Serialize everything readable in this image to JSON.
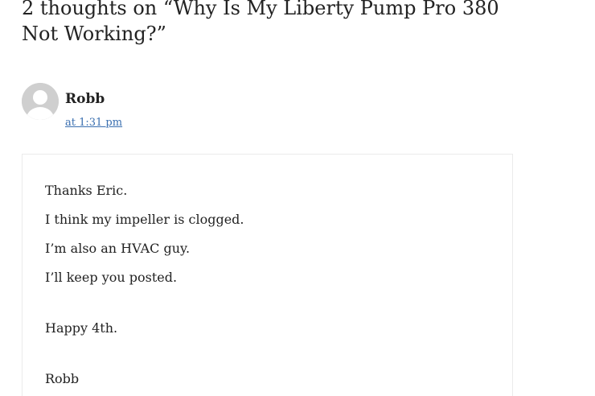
{
  "comments_title": "2 thoughts on “Why Is My Liberty Pump Pro 380 Not Working?”",
  "comment": {
    "author": "Robb",
    "time": "at 1:31 pm",
    "avatar_icon": "default-avatar-icon",
    "lines": [
      "Thanks Eric.",
      "I think my impeller is clogged.",
      "I’m also an HVAC guy.",
      "I’ll keep you posted.",
      "Happy 4th.",
      "Robb"
    ]
  },
  "colors": {
    "text": "#222222",
    "link": "#3a6fb0",
    "avatar_bg": "#cfcfcf",
    "box_border": "#ebebeb"
  }
}
